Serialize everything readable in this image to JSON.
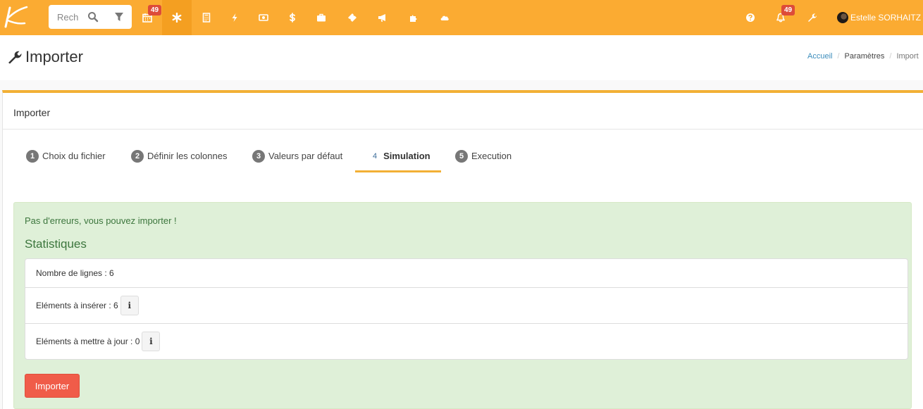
{
  "navbar": {
    "search": {
      "placeholder": "Rechercher"
    },
    "calendar_badge": "49",
    "notifications_badge": "49",
    "user_name": "Estelle SORHAITZ",
    "icons": [
      "calendar-icon",
      "asterisk-icon",
      "calculator-icon",
      "bolt-icon",
      "banknote-icon",
      "dollar-icon",
      "briefcase-icon",
      "ticket-icon",
      "bullhorn-icon",
      "puzzle-icon",
      "cloud-icon",
      "help-icon",
      "bell-icon",
      "wrench-icon"
    ],
    "colors": {
      "bar": "#fbab32",
      "active": "#f49f21",
      "badge": "#dd4b39"
    }
  },
  "page": {
    "title": "Importer",
    "breadcrumb": [
      "Accueil",
      "Paramètres",
      "Import"
    ]
  },
  "box": {
    "title": "Importer",
    "steps": [
      {
        "num": "1",
        "label": "Choix du fichier"
      },
      {
        "num": "2",
        "label": "Définir les colonnes"
      },
      {
        "num": "3",
        "label": "Valeurs par défaut"
      },
      {
        "num": "4",
        "label": "Simulation",
        "active": true
      },
      {
        "num": "5",
        "label": "Execution"
      }
    ]
  },
  "alert": {
    "message": "Pas d'erreurs, vous pouvez importer !",
    "stats_title": "Statistiques",
    "rows": [
      {
        "label": "Nombre de lignes : 6"
      },
      {
        "label": "Eléments à insérer : 6",
        "info": "i"
      },
      {
        "label": "Eléments à mettre à jour : 0",
        "info": "i"
      }
    ],
    "import_button": "Importer",
    "colors": {
      "background": "#dff0d8",
      "text": "#3c763d",
      "button": "#f05c49",
      "accent": "#f2b035"
    }
  }
}
